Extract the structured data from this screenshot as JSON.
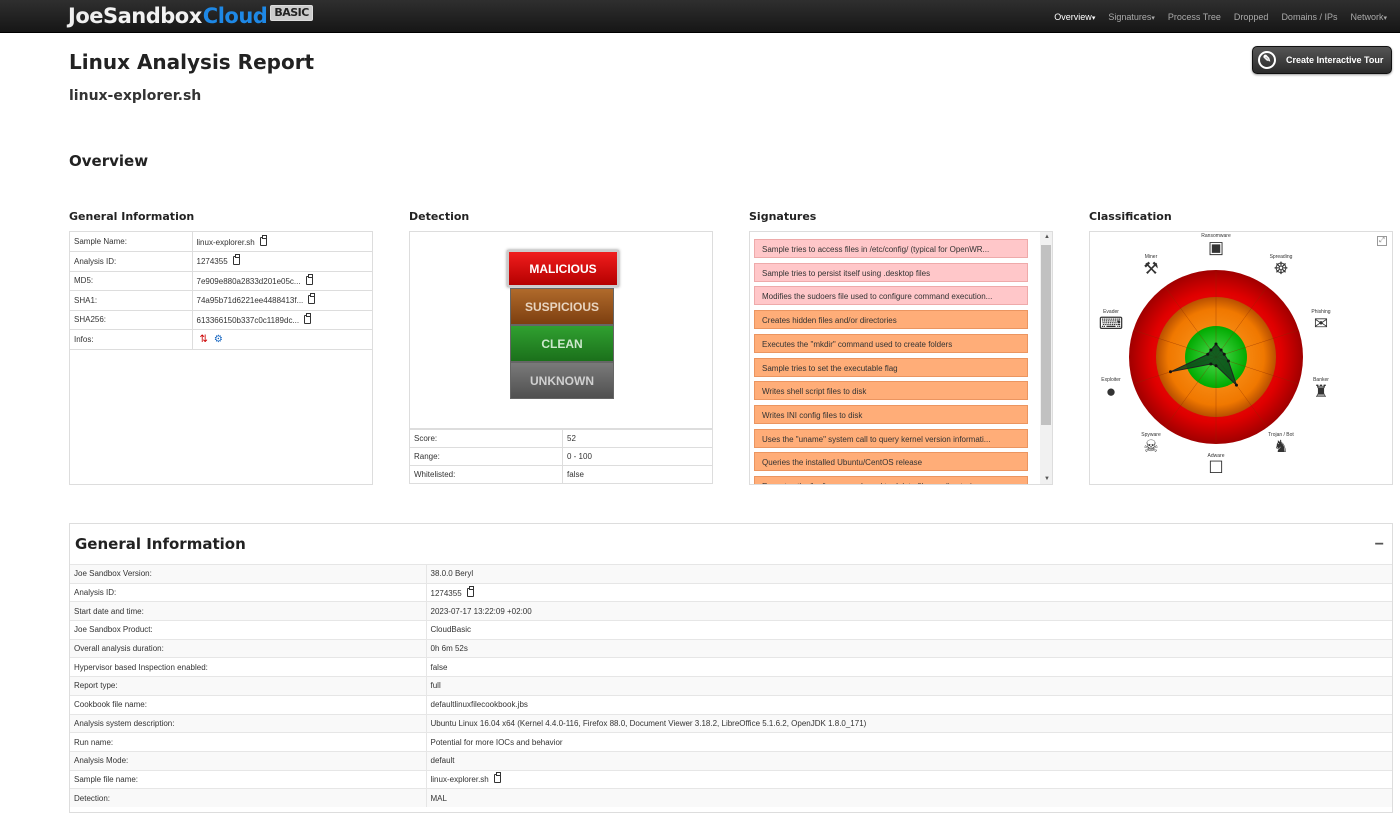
{
  "brand": {
    "joe": "J",
    "oe": "oe",
    "sandbox": "Sandbox",
    "cloud": "Cloud",
    "tier": "BASIC"
  },
  "nav": {
    "items": [
      {
        "label": "Overview",
        "caret": true,
        "active": true
      },
      {
        "label": "Signatures",
        "caret": true,
        "active": false
      },
      {
        "label": "Process Tree",
        "caret": false,
        "active": false
      },
      {
        "label": "Dropped",
        "caret": false,
        "active": false
      },
      {
        "label": "Domains / IPs",
        "caret": false,
        "active": false
      },
      {
        "label": "Network",
        "caret": true,
        "active": false
      }
    ]
  },
  "page": {
    "title": "Linux Analysis Report",
    "subtitle": "linux-explorer.sh",
    "tour_button": "Create Interactive Tour",
    "overview_heading": "Overview"
  },
  "panels": {
    "general_information": "General Information",
    "detection": "Detection",
    "signatures": "Signatures",
    "classification": "Classification"
  },
  "general_info": {
    "rows": [
      {
        "key": "Sample Name:",
        "value": "linux-explorer.sh",
        "copy": true
      },
      {
        "key": "Analysis ID:",
        "value": "1274355",
        "copy": true
      },
      {
        "key": "MD5:",
        "value": "7e909e880a2833d201e05c...",
        "copy": true
      },
      {
        "key": "SHA1:",
        "value": "74a95b71d6221ee4488413f...",
        "copy": true
      },
      {
        "key": "SHA256:",
        "value": "613366150b337c0c1189dc...",
        "copy": true
      },
      {
        "key": "Infos:",
        "value": "",
        "copy": false
      }
    ]
  },
  "detection": {
    "levels": [
      "MALICIOUS",
      "SUSPICIOUS",
      "CLEAN",
      "UNKNOWN"
    ],
    "selected": "MALICIOUS",
    "rows": [
      {
        "key": "Score:",
        "value": "52"
      },
      {
        "key": "Range:",
        "value": "0 - 100"
      },
      {
        "key": "Whitelisted:",
        "value": "false"
      }
    ]
  },
  "signatures": [
    {
      "text": "Sample tries to access files in /etc/config/ (typical for OpenWR...",
      "severity": "pink"
    },
    {
      "text": "Sample tries to persist itself using .desktop files",
      "severity": "pink"
    },
    {
      "text": "Modifies the sudoers file used to configure command execution...",
      "severity": "pink"
    },
    {
      "text": "Creates hidden files and/or directories",
      "severity": "orange"
    },
    {
      "text": "Executes the \"mkdir\" command used to create folders",
      "severity": "orange"
    },
    {
      "text": "Sample tries to set the executable flag",
      "severity": "orange"
    },
    {
      "text": "Writes shell script files to disk",
      "severity": "orange"
    },
    {
      "text": "Writes INI config files to disk",
      "severity": "orange"
    },
    {
      "text": "Uses the \"uname\" system call to query kernel version informati...",
      "severity": "orange"
    },
    {
      "text": "Queries the installed Ubuntu/CentOS release",
      "severity": "orange"
    },
    {
      "text": "Executes the \"rm\" command used to delete files or directories",
      "severity": "orange"
    }
  ],
  "classification": {
    "categories": [
      "Ransomware",
      "Spreading",
      "Phishing",
      "Banker",
      "Trojan / Bot",
      "Adware",
      "Spyware",
      "Exploiter",
      "Evader",
      "Miner"
    ],
    "icons": [
      "ransomware-icon",
      "spreading-icon",
      "phishing-icon",
      "banker-icon",
      "trojan-icon",
      "adware-icon",
      "spyware-icon",
      "exploiter-icon",
      "evader-icon",
      "miner-icon"
    ],
    "radar_values": [
      0.15,
      0.1,
      0.1,
      0.15,
      0.4,
      0.1,
      0.1,
      0.55,
      0.1,
      0.1
    ],
    "colors": {
      "outer": "#e00000",
      "middle": "#f07800",
      "inner": "#00aa00",
      "center": "#0a5a1a"
    }
  },
  "general_section": {
    "title": "General Information",
    "collapse": "−",
    "rows": [
      {
        "key": "Joe Sandbox Version:",
        "value": "38.0.0 Beryl",
        "copy": false
      },
      {
        "key": "Analysis ID:",
        "value": "1274355",
        "copy": true
      },
      {
        "key": "Start date and time:",
        "value": "2023-07-17 13:22:09 +02:00",
        "copy": false
      },
      {
        "key": "Joe Sandbox Product:",
        "value": "CloudBasic",
        "copy": false
      },
      {
        "key": "Overall analysis duration:",
        "value": "0h 6m 52s",
        "copy": false
      },
      {
        "key": "Hypervisor based Inspection enabled:",
        "value": "false",
        "copy": false
      },
      {
        "key": "Report type:",
        "value": "full",
        "copy": false
      },
      {
        "key": "Cookbook file name:",
        "value": "defaultlinuxfilecookbook.jbs",
        "copy": false
      },
      {
        "key": "Analysis system description:",
        "value": "Ubuntu Linux 16.04 x64 (Kernel 4.4.0-116, Firefox 88.0, Document Viewer 3.18.2, LibreOffice 5.1.6.2, OpenJDK 1.8.0_171)",
        "copy": false
      },
      {
        "key": "Run name:",
        "value": "Potential for more IOCs and behavior",
        "copy": false
      },
      {
        "key": "Analysis Mode:",
        "value": "default",
        "copy": false
      },
      {
        "key": "Sample file name:",
        "value": "linux-explorer.sh",
        "copy": true
      },
      {
        "key": "Detection:",
        "value": "MAL",
        "copy": false
      }
    ]
  }
}
